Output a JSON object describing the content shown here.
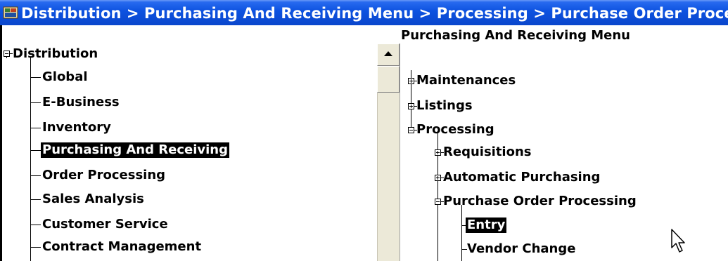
{
  "window": {
    "title": "Distribution > Purchasing And Receiving Menu > Processing > Purchase Order Processing"
  },
  "left_tree": {
    "root": "Distribution",
    "items": [
      {
        "label": "Global",
        "selected": false
      },
      {
        "label": "E-Business",
        "selected": false
      },
      {
        "label": "Inventory",
        "selected": false
      },
      {
        "label": "Purchasing And Receiving",
        "selected": true
      },
      {
        "label": "Order Processing",
        "selected": false
      },
      {
        "label": "Sales Analysis",
        "selected": false
      },
      {
        "label": "Customer Service",
        "selected": false
      },
      {
        "label": "Contract Management",
        "selected": false
      }
    ]
  },
  "right_tree": {
    "header": "Purchasing And Receiving Menu",
    "items": [
      {
        "label": "Maintenances",
        "expanded": false
      },
      {
        "label": "Listings",
        "expanded": false
      },
      {
        "label": "Processing",
        "expanded": true
      },
      {
        "label": "Requisitions",
        "expanded": false
      },
      {
        "label": "Automatic Purchasing",
        "expanded": false
      },
      {
        "label": "Purchase Order Processing",
        "expanded": true
      },
      {
        "label": "Entry",
        "selected": true
      },
      {
        "label": "Vendor Change",
        "selected": false
      }
    ]
  },
  "icons": {
    "app": "app-window-icon",
    "scroll_up": "scroll-up-arrow-icon",
    "cursor": "mouse-pointer-icon"
  },
  "colors": {
    "titlebar": "#0a46cc",
    "selection_bg": "#000000",
    "selection_fg": "#ffffff"
  }
}
